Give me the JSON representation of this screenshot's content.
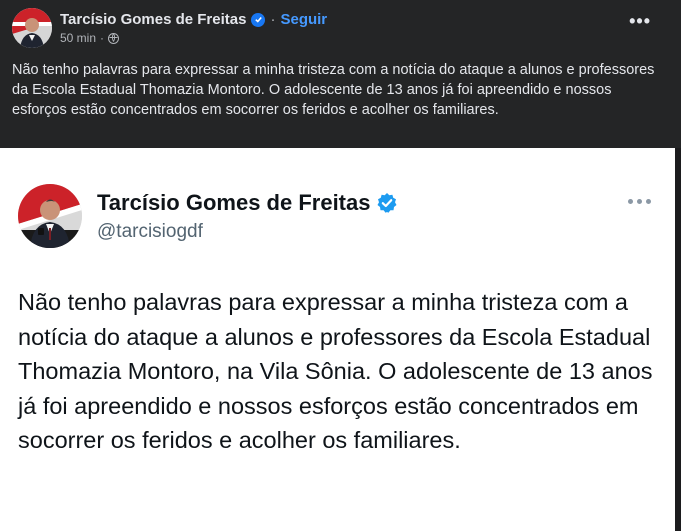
{
  "facebook_post": {
    "author": "Tarcísio Gomes de Freitas",
    "separator": "·",
    "follow_label": "Seguir",
    "timestamp": "50 min",
    "meta_separator": "·",
    "more_label": "•••",
    "text": "Não tenho palavras para expressar a minha tristeza com a notícia do ataque a alunos e professores da Escola Estadual Thomazia Montoro. O adolescente de 13 anos já foi apreendido e nossos esforços estão concentrados em socorrer os feridos e acolher os familiares.",
    "verified_color": "#1877f2",
    "follow_color": "#4599ff",
    "background": "#242526"
  },
  "tweet": {
    "author": "Tarcísio Gomes de Freitas",
    "handle": "@tarcisiogdf",
    "text": "Não tenho palavras para expressar a minha tristeza com a notícia do ataque a alunos e professores da Escola Estadual Thomazia Montoro, na Vila Sônia. O adolescente de 13 anos já foi apreendido e nossos esforços estão concentrados em socorrer os feridos e acolher os familiares.",
    "verified_color": "#1d9bf0"
  }
}
